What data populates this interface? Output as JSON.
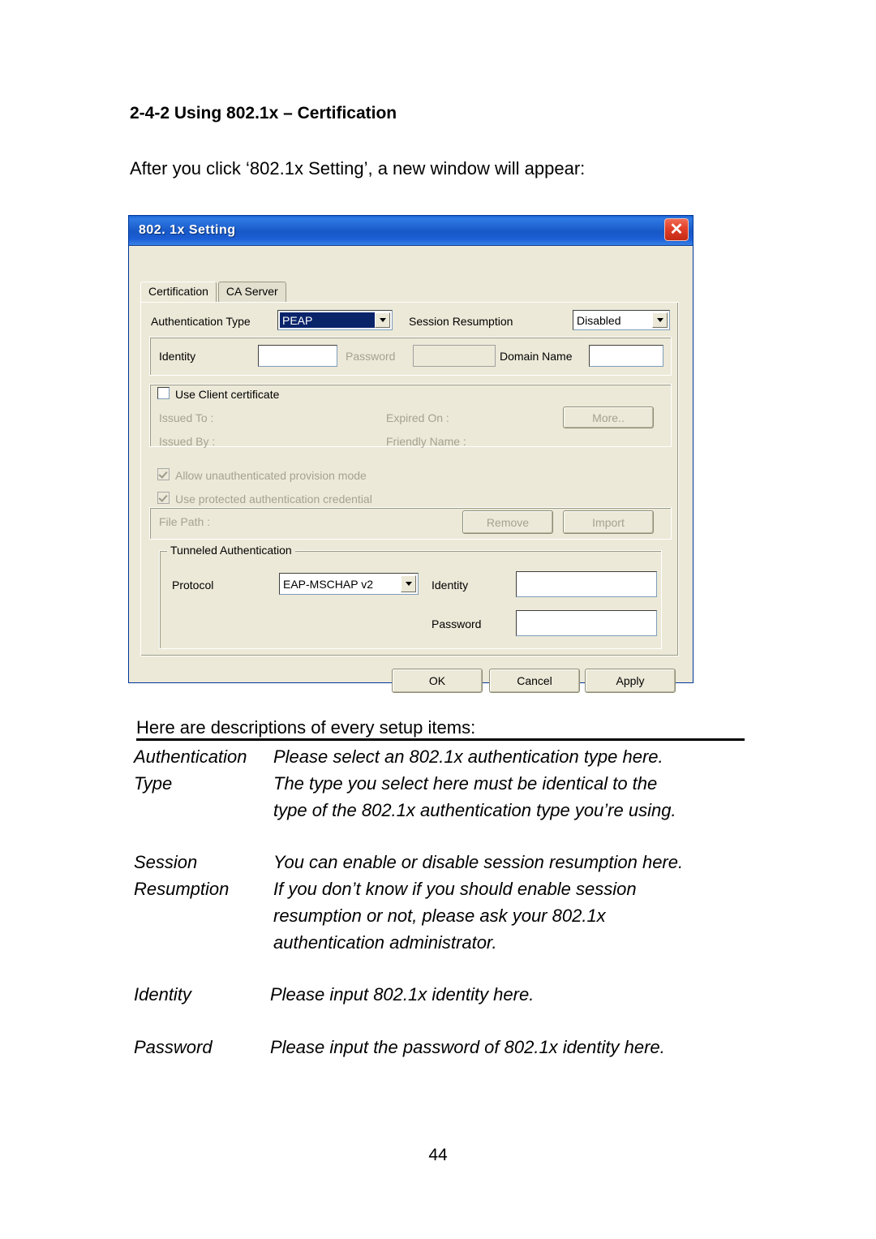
{
  "document": {
    "heading": "2-4-2 Using 802.1x – Certification",
    "intro": "After you click ‘802.1x Setting’, a new window will appear:",
    "descriptions_intro": "Here are descriptions of every setup items:",
    "page_number": "44"
  },
  "dialog": {
    "title": "802. 1x Setting",
    "close_label": "✕",
    "tabs": [
      {
        "label": "Certification",
        "active": true
      },
      {
        "label": "CA Server",
        "active": false
      }
    ],
    "authentication_type": {
      "label": "Authentication Type",
      "value": "PEAP"
    },
    "session_resumption": {
      "label": "Session Resumption",
      "value": "Disabled"
    },
    "identity": {
      "label": "Identity",
      "value": ""
    },
    "password": {
      "label": "Password",
      "value": ""
    },
    "domain_name": {
      "label": "Domain Name",
      "value": ""
    },
    "use_client_certificate": {
      "label": "Use Client certificate",
      "checked": false
    },
    "cert_fields": {
      "issued_to": "Issued To :",
      "expired_on": "Expired On :",
      "issued_by": "Issued By :",
      "friendly_name": "Friendly Name :",
      "more_button": "More.."
    },
    "allow_unauth": {
      "label": "Allow unauthenticated provision mode",
      "checked": true
    },
    "use_protected_credential": {
      "label": "Use protected authentication credential",
      "checked": true
    },
    "file_path": {
      "label": "File Path :",
      "value": ""
    },
    "remove_button": "Remove",
    "import_button": "Import",
    "tunneled_authentication": {
      "title": "Tunneled Authentication",
      "protocol_label": "Protocol",
      "protocol_value": "EAP-MSCHAP v2",
      "identity_label": "Identity",
      "identity_value": "",
      "password_label": "Password",
      "password_value": ""
    },
    "buttons": {
      "ok": "OK",
      "cancel": "Cancel",
      "apply": "Apply"
    }
  },
  "descriptions": [
    {
      "term_lines": [
        "Authentication",
        "Type"
      ],
      "def_lines": [
        "Please select an 802.1x authentication type here.",
        "The type you select here must be identical to the",
        "type of the 802.1x authentication type you’re using."
      ]
    },
    {
      "term_lines": [
        "Session",
        "Resumption"
      ],
      "def_lines": [
        "You can enable or disable session resumption here.",
        "If you don’t know if you should enable session",
        "resumption or not, please ask your 802.1x",
        "authentication administrator."
      ]
    },
    {
      "term_lines": [
        "Identity"
      ],
      "def_lines": [
        "Please input 802.1x identity here."
      ]
    },
    {
      "term_lines": [
        "Password"
      ],
      "def_lines": [
        "Please input the password of 802.1x identity here."
      ]
    }
  ]
}
